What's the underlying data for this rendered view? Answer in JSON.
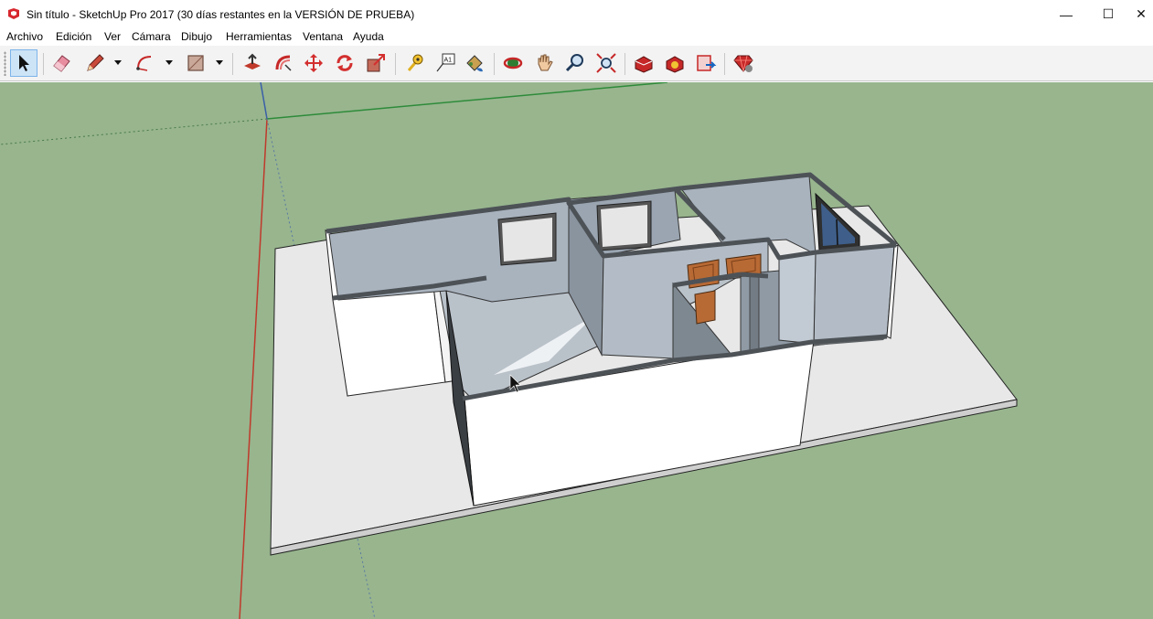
{
  "window": {
    "title": "Sin título - SketchUp Pro 2017 (30 días restantes en la VERSIÓN DE PRUEBA)",
    "minimize_glyph": "—",
    "maximize_glyph": "☐",
    "close_glyph": "✕"
  },
  "menu": {
    "items": [
      "Archivo",
      "Edición",
      "Ver",
      "Cámara",
      "Dibujo",
      "Herramientas",
      "Ventana",
      "Ayuda"
    ]
  },
  "toolbar": {
    "tools": [
      {
        "name": "select-tool",
        "icon": "cursor-arrow-icon",
        "active": true
      },
      {
        "name": "eraser-tool",
        "icon": "eraser-icon"
      },
      {
        "name": "line-tool",
        "icon": "pencil-icon"
      },
      {
        "name": "arc-tool",
        "icon": "arc-icon"
      },
      {
        "name": "shape-tool",
        "icon": "rectangle-icon"
      },
      {
        "name": "push-pull-tool",
        "icon": "push-pull-icon"
      },
      {
        "name": "offset-tool",
        "icon": "offset-icon"
      },
      {
        "name": "move-tool",
        "icon": "move-arrows-icon"
      },
      {
        "name": "rotate-tool",
        "icon": "rotate-icon"
      },
      {
        "name": "scale-tool",
        "icon": "scale-icon"
      },
      {
        "name": "tape-measure-tool",
        "icon": "tape-measure-icon"
      },
      {
        "name": "text-tool",
        "icon": "text-label-icon"
      },
      {
        "name": "paint-bucket-tool",
        "icon": "paint-bucket-icon"
      },
      {
        "name": "orbit-tool",
        "icon": "orbit-icon"
      },
      {
        "name": "pan-tool",
        "icon": "hand-icon"
      },
      {
        "name": "zoom-tool",
        "icon": "magnifier-icon"
      },
      {
        "name": "zoom-extents-tool",
        "icon": "zoom-extents-icon"
      },
      {
        "name": "3d-warehouse-tool",
        "icon": "warehouse-icon"
      },
      {
        "name": "extension-warehouse-tool",
        "icon": "extension-warehouse-icon"
      },
      {
        "name": "send-to-layout-tool",
        "icon": "layout-icon"
      },
      {
        "name": "extension-manager-tool",
        "icon": "ruby-gem-icon"
      }
    ],
    "text_tool_label": "A1"
  },
  "colors": {
    "ground": "#98b58e",
    "base_slab": "#e8e8e8",
    "interior_wall": "#aab4bf",
    "exterior_wall": "#ffffff",
    "wall_top": "#5f6366",
    "door": "#b86a35",
    "window_glass": "#3f5f8a",
    "axis_red": "#c0392b",
    "axis_green": "#2e8b3a",
    "axis_blue": "#3a5fa8"
  }
}
